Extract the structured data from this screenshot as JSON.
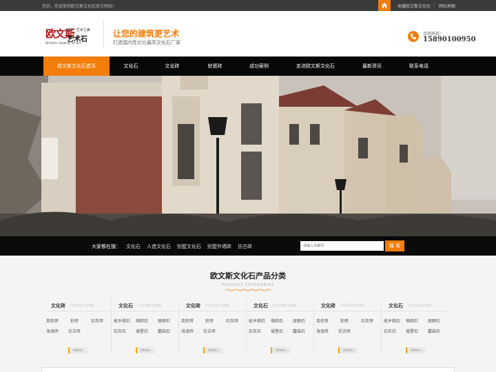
{
  "topbar": {
    "welcome": "您好，欢迎来到欧文斯文化石官方网站！",
    "favorite": "收藏欧文斯文化石",
    "separator": "|",
    "sitemap": "网站地图"
  },
  "header": {
    "logo_main": "欧文斯",
    "logo_tag": "自然 · 艺术之美",
    "logo_sub": "艺术石",
    "logo_en": "Artistic beauty of art",
    "slogan": "让您的建筑更艺术",
    "subslogan": "打造国内性价比最高文化石厂家",
    "hotline_label": "咨询热线：",
    "hotline_number": "15890100950"
  },
  "nav": [
    {
      "label": "欧文斯文化石首页",
      "active": true
    },
    {
      "label": "文化石"
    },
    {
      "label": "文化砖"
    },
    {
      "label": "软瓷砖"
    },
    {
      "label": "成功案例"
    },
    {
      "label": "走进欧文斯文化石"
    },
    {
      "label": "最新资讯"
    },
    {
      "label": "联系电话"
    }
  ],
  "search": {
    "label": "大家都在搜：",
    "keywords": [
      "文化石",
      "人造文化石",
      "别墅文化石",
      "别墅外墙砖",
      "仿古砖"
    ],
    "placeholder": "请输入关键词",
    "button": "搜 索"
  },
  "products": {
    "title": "欧文斯文化石产品分类",
    "subtitle": "PRODUCT CATEGORIES",
    "more_label": "MORE+",
    "category_en": "/ CULTURE STONE",
    "columns": [
      {
        "heading": "文化砖",
        "links": [
          "英伦砖",
          "彩砖",
          "石灰砖",
          "海浪砖",
          "仿古砖"
        ]
      },
      {
        "heading": "文化石",
        "links": [
          "故乡桃石",
          "堆砌石",
          "原野石",
          "石灰石",
          "城堡石",
          "蘑菇石"
        ]
      },
      {
        "heading": "文化砖",
        "links": [
          "英伦砖",
          "彩砖",
          "石灰砖",
          "海浪砖",
          "仿古砖"
        ]
      },
      {
        "heading": "文化石",
        "links": [
          "故乡桃石",
          "堆砌石",
          "原野石",
          "石灰石",
          "城堡石",
          "蘑菇石"
        ]
      },
      {
        "heading": "文化砖",
        "links": [
          "英伦砖",
          "彩砖",
          "石灰砖",
          "海浪砖",
          "仿古砖"
        ]
      },
      {
        "heading": "文化石",
        "links": [
          "故乡桃石",
          "堆砌石",
          "原野石",
          "石灰石",
          "城堡石",
          "蘑菇石"
        ]
      }
    ]
  },
  "colors": {
    "accent": "#f27d0b",
    "topbar_bg": "#3a3a3a",
    "nav_bg": "#080808"
  },
  "icons": {
    "home": "home-icon",
    "phone": "phone-icon"
  }
}
